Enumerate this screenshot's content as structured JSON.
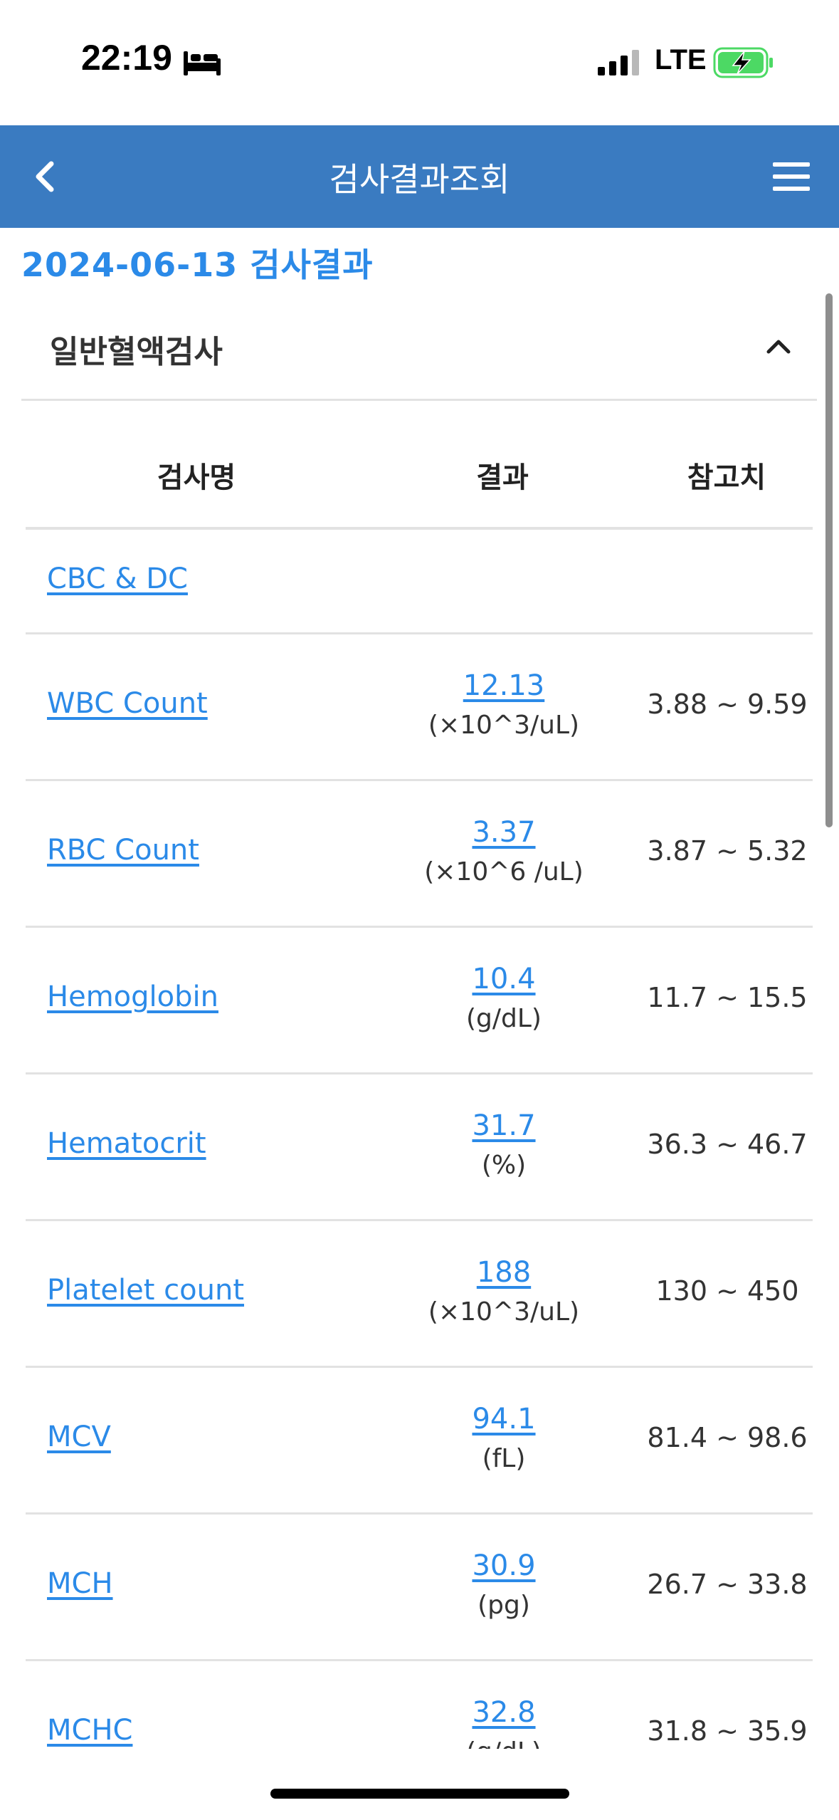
{
  "status_bar": {
    "time": "22:19",
    "network": "LTE"
  },
  "header": {
    "title": "검사결과조회"
  },
  "result_date_title": "2024-06-13 검사결과",
  "section": {
    "title": "일반혈액검사"
  },
  "table": {
    "headers": {
      "name": "검사명",
      "result": "결과",
      "reference": "참고치"
    },
    "group_label": "CBC & DC",
    "rows": [
      {
        "name": "WBC Count",
        "value": "12.13",
        "unit": "(×10^3/uL)",
        "reference": "3.88 ~ 9.59"
      },
      {
        "name": "RBC Count",
        "value": "3.37",
        "unit": "(×10^6 /uL)",
        "reference": "3.87 ~ 5.32"
      },
      {
        "name": "Hemoglobin",
        "value": "10.4",
        "unit": "(g/dL)",
        "reference": "11.7 ~ 15.5"
      },
      {
        "name": "Hematocrit",
        "value": "31.7",
        "unit": "(%)",
        "reference": "36.3 ~ 46.7"
      },
      {
        "name": "Platelet count",
        "value": "188",
        "unit": "(×10^3/uL)",
        "reference": "130 ~ 450"
      },
      {
        "name": "MCV",
        "value": "94.1",
        "unit": "(fL)",
        "reference": "81.4 ~ 98.6"
      },
      {
        "name": "MCH",
        "value": "30.9",
        "unit": "(pg)",
        "reference": "26.7 ~ 33.8"
      },
      {
        "name": "MCHC",
        "value": "32.8",
        "unit": "(g/dL)",
        "reference": "31.8 ~ 35.9"
      }
    ]
  },
  "icons": {
    "back": "chevron-left-icon",
    "menu": "hamburger-menu-icon",
    "collapse": "chevron-up-icon",
    "sleep": "bed-icon",
    "signal": "cellular-signal-icon",
    "battery": "battery-charging-icon"
  },
  "colors": {
    "header_bg": "#3a7bc1",
    "link_blue": "#2b8ae8",
    "battery_green": "#4cd964"
  }
}
